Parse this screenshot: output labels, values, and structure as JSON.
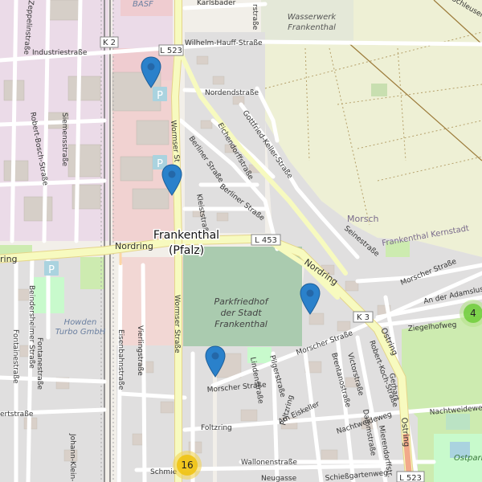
{
  "map": {
    "city_label": "Frankenthal",
    "city_label_2": "(Pfalz)",
    "cemetery_label": [
      "Parkfriedhof",
      "der Stadt",
      "Frankenthal"
    ],
    "waterworks_label": [
      "Wasserwerk",
      "Frankenthal"
    ],
    "district_morsch": "Morsch",
    "district_kernstadt": "Frankenthal Kernstadt",
    "company_label": [
      "Howden",
      "Turbo GmbH"
    ],
    "basf_label": "BASF",
    "ostpark_label": "Ostpark",
    "roads": {
      "industriestrasse": "Industriestraße",
      "k2": "K 2",
      "l523_top": "L 523",
      "wilhelm_hauff": "Wilhelm-Hauff-Straße",
      "karlsbader": "Karlsbader",
      "nordendstrasse": "Nordendstraße",
      "wormser_top": "Wormser St",
      "berliner_1": "Berliner Straße",
      "berliner_2": "Berliner Straße",
      "eichendorff": "Eichendorffstraße",
      "gottfried_keller": "Gottfried-Keller-Straße",
      "kleiststrasse": "Kleiststraße",
      "nordring_w": "Nordring",
      "nordring_e": "Nordring",
      "ring_w": "ring",
      "l453": "L 453",
      "seinestrasse": "Seinestraße",
      "morscher_e": "Morscher Straße",
      "morscher_mid": "Morscher Straße",
      "morscher_sw": "Morscher Straße",
      "an_der_adamslust": "An der Adamslust",
      "ziegelhofweg": "Ziegelhofweg",
      "k3": "K 3",
      "ostring": "Ostring",
      "ostring_2": "Ostring",
      "wormser_s": "Wormser Straße",
      "eisenbahnstrasse": "Eisenbahnstraße",
      "vierlingstrasse": "Vierlingstraße",
      "beindersheimer": "Beindersheimer Straße",
      "fontanestrasse": "Fontanestraße",
      "fontainestrasse": "Fontainestraße",
      "siemensstrasse": "Siemensstraße",
      "robert_bosch": "Robert-Bosch-Straße",
      "zeppelinstrasse": "Zeppelinstraße",
      "schleusenweg": "Schleusenweg",
      "victorstrasse": "Victorstraße",
      "robert_koch": "Robert-Koch-Straße",
      "brentanostrasse": "Brentanostraße",
      "nachtweideweg": "Nachtweideweg",
      "nachtweideweg_2": "Nachtweideweg",
      "foltzring": "Foltzring",
      "foltzring_2": "Foltzring",
      "am_eiskeller": "Am Eiskeller",
      "pilgerstrasse": "Pilgerstraße",
      "lindenstrasse": "Lindenstraße",
      "wallonenstrasse": "Wallonenstraße",
      "neugasse": "Neugasse",
      "schiessgartenweg": "Schießgartenweg",
      "johann_klein": "Johann-Klein-Str.",
      "schmie": "Schmie",
      "dammstrasse": "Dammstraße",
      "mierendorf": "Mierendorffstr.",
      "l523_bottom": "L 523",
      "ertstrasse": "ertstraße",
      "gerhart": "Gerhart",
      "rstrasse": "rstraße"
    },
    "parking_symbol": "P",
    "markers": [
      {
        "name": "marker-1",
        "color": "#2a81cb"
      },
      {
        "name": "marker-2",
        "color": "#2a81cb"
      },
      {
        "name": "marker-3",
        "color": "#2a81cb"
      },
      {
        "name": "marker-4",
        "color": "#2a81cb"
      }
    ],
    "clusters": {
      "green_count": "4",
      "orange_count": "16"
    }
  }
}
